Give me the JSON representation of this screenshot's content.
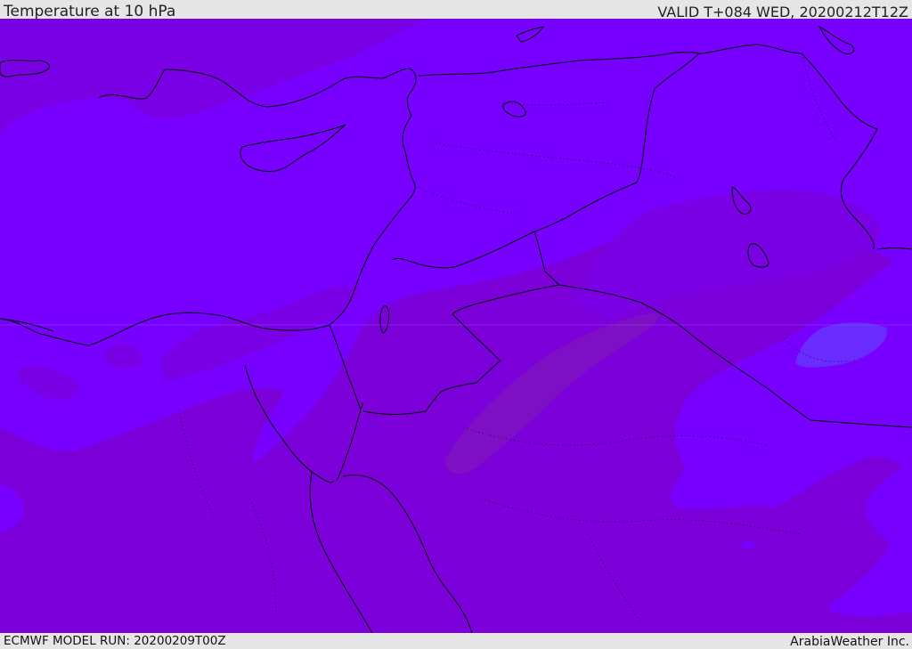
{
  "header": {
    "title": "Temperature at 10 hPa",
    "valid": "VALID T+084 WED, 20200212T12Z"
  },
  "footer": {
    "model_run": "ECMWF MODEL RUN: 20200209T00Z",
    "credit": "ArabiaWeather Inc."
  },
  "map": {
    "colors": {
      "band_warm": "#7700ff",
      "band_cool": "#7c00d9",
      "band_mid": "#7800e8",
      "band_coldest": "#7d10c4",
      "band_warmest": "#6633ff",
      "coastline": "#000000",
      "bar_background": "#e6e6e6"
    }
  }
}
